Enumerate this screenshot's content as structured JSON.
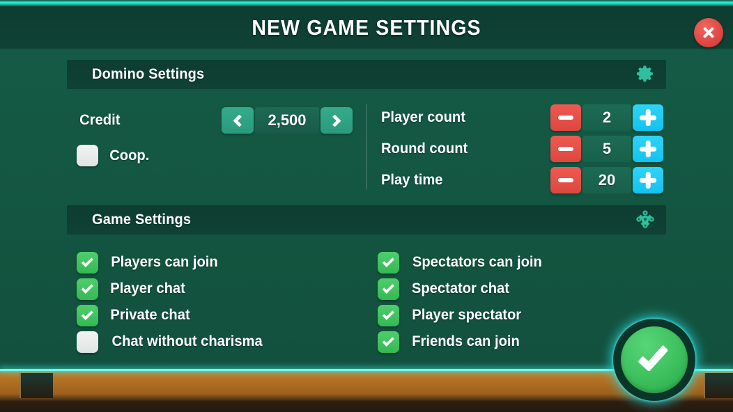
{
  "window": {
    "title": "NEW GAME SETTINGS",
    "close_icon": "close-x-icon"
  },
  "theme": {
    "neon": "#2fe8cf",
    "panel_header_bg": "#0d3d30",
    "page_bg": "#155c47",
    "teal_button": "#2fa084",
    "minus_red": "#e04a45",
    "plus_cyan": "#19c8f0",
    "check_green": "#3cbf5c",
    "close_red": "#e04a45",
    "wood": "#b06f22"
  },
  "domino_section": {
    "title": "Domino Settings",
    "icon": "gear-icon",
    "credit": {
      "label": "Credit",
      "value": "2,500",
      "prev_icon": "chevron-left-icon",
      "next_icon": "chevron-right-icon"
    },
    "coop": {
      "label": "Coop.",
      "checked": false
    },
    "counters": [
      {
        "label": "Player count",
        "value": "2",
        "minus_icon": "minus-icon",
        "plus_icon": "plus-icon"
      },
      {
        "label": "Round count",
        "value": "5",
        "minus_icon": "minus-icon",
        "plus_icon": "plus-icon"
      },
      {
        "label": "Play time",
        "value": "20",
        "minus_icon": "minus-icon",
        "plus_icon": "plus-icon"
      }
    ]
  },
  "game_section": {
    "title": "Game Settings",
    "icon": "cog-icon",
    "left_options": [
      {
        "label": "Players can join",
        "checked": true
      },
      {
        "label": "Player chat",
        "checked": true
      },
      {
        "label": "Private chat",
        "checked": true
      },
      {
        "label": "Chat without charisma",
        "checked": false
      }
    ],
    "right_options": [
      {
        "label": "Spectators can join",
        "checked": true
      },
      {
        "label": "Spectator chat",
        "checked": true
      },
      {
        "label": "Player spectator",
        "checked": true
      },
      {
        "label": "Friends can join",
        "checked": true
      }
    ]
  },
  "confirm": {
    "icon": "checkmark-icon"
  }
}
